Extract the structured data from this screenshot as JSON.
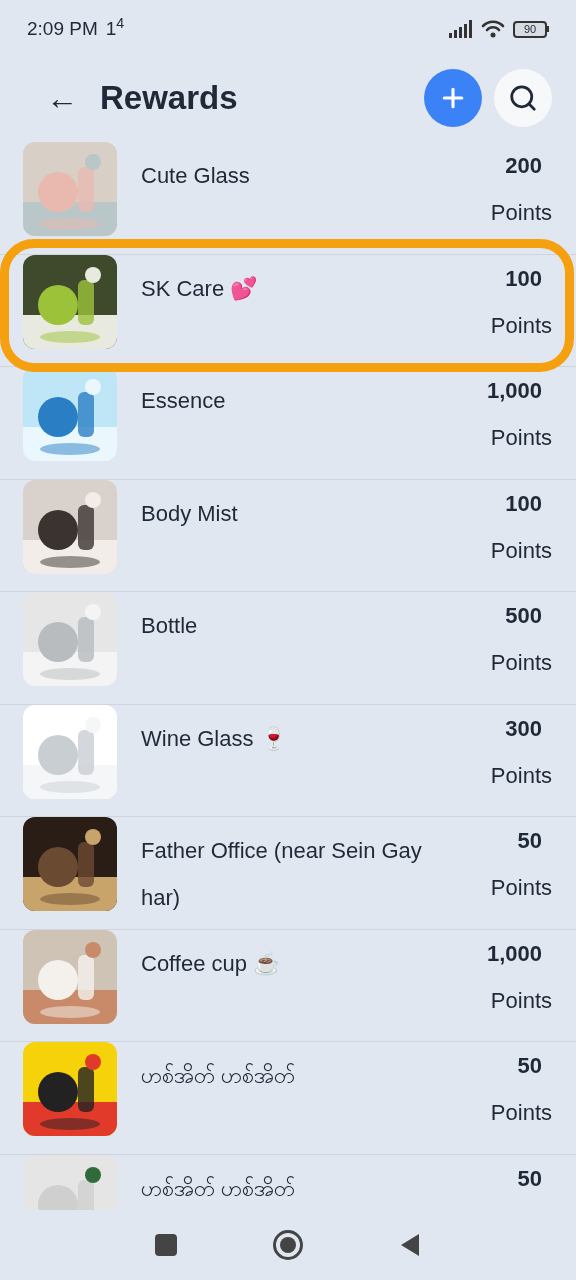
{
  "status_bar": {
    "time": "2:09 PM",
    "notification": "1$^{4}$",
    "battery": "90"
  },
  "header": {
    "back": "←",
    "title": "Rewards"
  },
  "rewards": [
    {
      "name": "Cute Glass",
      "points": "200",
      "points_label": "Points",
      "highlighted": false
    },
    {
      "name": "SK Care 💕",
      "points": "100",
      "points_label": "Points",
      "highlighted": true
    },
    {
      "name": "Essence",
      "points": "1,000",
      "points_label": "Points",
      "highlighted": false
    },
    {
      "name": "Body Mist",
      "points": "100",
      "points_label": "Points",
      "highlighted": false
    },
    {
      "name": "Bottle",
      "points": "500",
      "points_label": "Points",
      "highlighted": false
    },
    {
      "name": "Wine Glass 🍷",
      "points": "300",
      "points_label": "Points",
      "highlighted": false
    },
    {
      "name": "Father Office (near Sein Gay har)",
      "points": "50",
      "points_label": "Points",
      "highlighted": false
    },
    {
      "name": "Coffee cup ☕",
      "points": "1,000",
      "points_label": "Points",
      "highlighted": false
    },
    {
      "name": "ဟစ်အိတ် ဟစ်အိတ်",
      "points": "50",
      "points_label": "Points",
      "highlighted": false
    },
    {
      "name": "ဟစ်အိတ် ဟစ်အိတ်",
      "points": "50",
      "highlighted": false
    }
  ]
}
